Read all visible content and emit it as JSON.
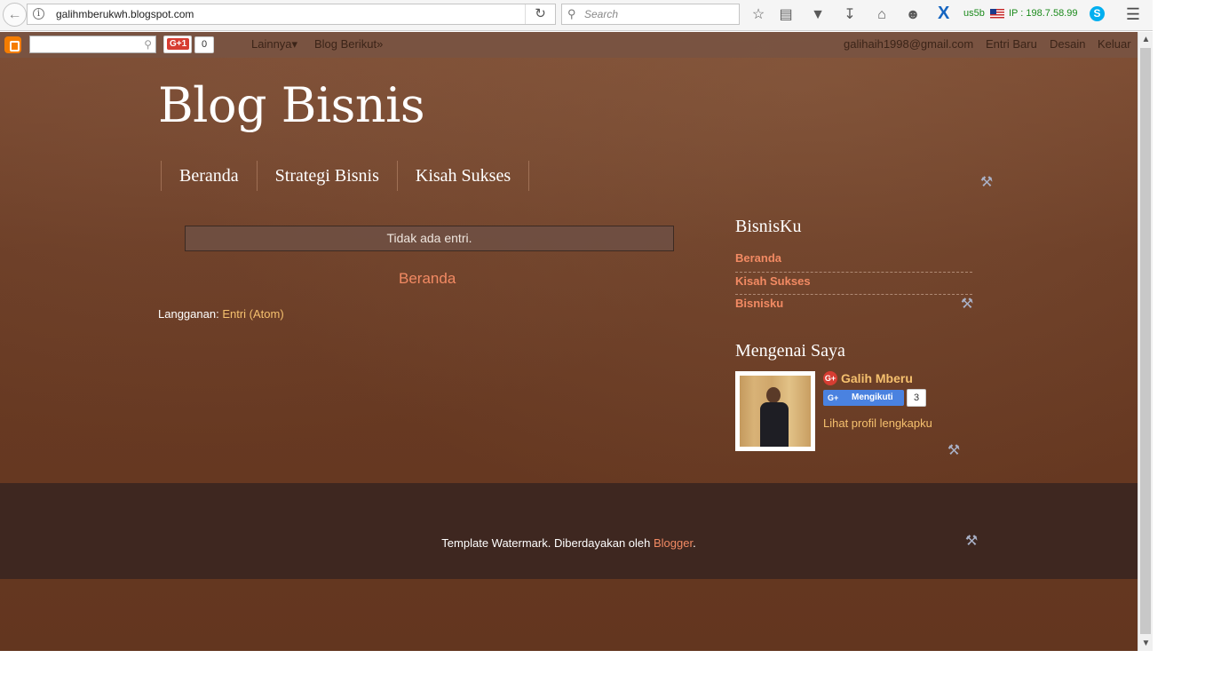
{
  "browser": {
    "url": "galihmberukwh.blogspot.com",
    "search_placeholder": "Search",
    "extension_label": "us5b",
    "ip_label": "IP : 198.7.58.99"
  },
  "navbar": {
    "gplus_label": "G+1",
    "gplus_count": "0",
    "more_label": "Lainnya▾",
    "next_blog_label": "Blog Berikut»",
    "email": "galihaih1998@gmail.com",
    "new_post_label": "Entri Baru",
    "design_label": "Desain",
    "logout_label": "Keluar"
  },
  "blog": {
    "title": "Blog Bisnis",
    "tabs": [
      "Beranda",
      "Strategi Bisnis",
      "Kisah Sukses"
    ]
  },
  "main": {
    "no_posts": "Tidak ada entri.",
    "home_link": "Beranda",
    "subscribe_label": "Langganan:",
    "subscribe_link": "Entri (Atom)"
  },
  "sidebar": {
    "bisnisku_title": "BisnisKu",
    "bisnisku_items": [
      "Beranda",
      "Kisah Sukses",
      "Bisnisku"
    ],
    "about_title": "Mengenai Saya",
    "profile_name": "Galih Mberu",
    "follow_label": "Mengikuti",
    "follow_gplus": "G+",
    "follow_count": "3",
    "profile_link": "Lihat profil lengkapku"
  },
  "footer": {
    "text": "Template Watermark. Diberdayakan oleh ",
    "link": "Blogger",
    "suffix": "."
  },
  "colors": {
    "background": "#6e3d25",
    "link": "#f28a63",
    "link_alt": "#f5c06e",
    "footer": "#3e2720"
  }
}
